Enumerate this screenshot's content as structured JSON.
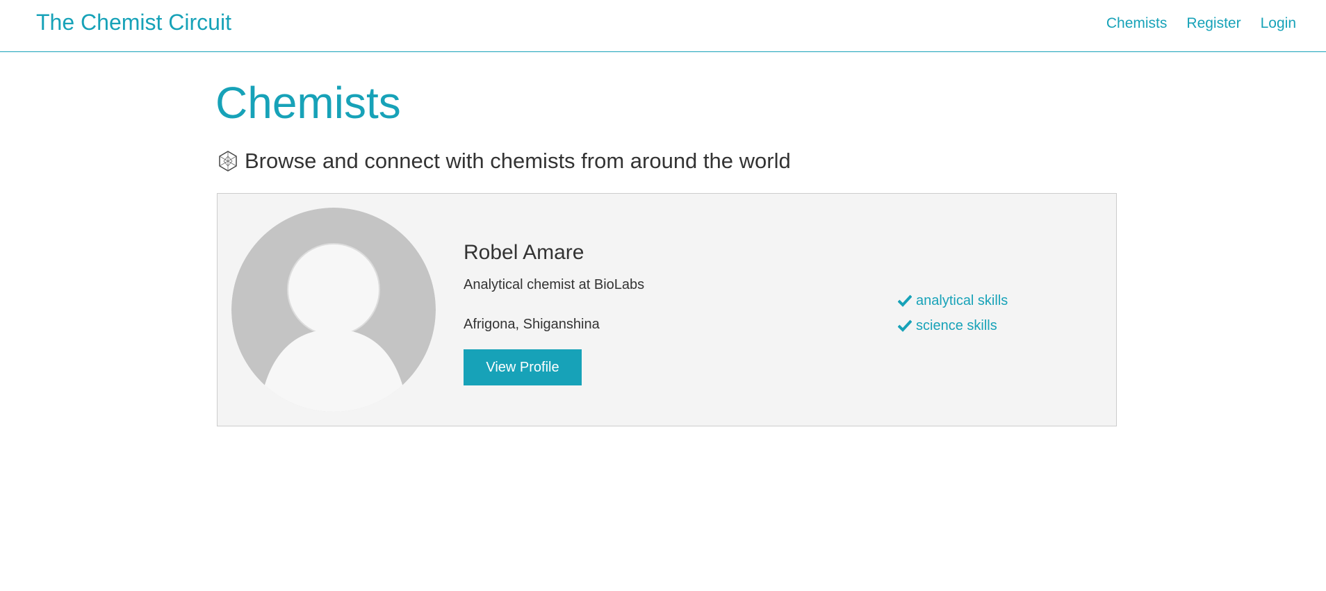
{
  "navbar": {
    "brand": "The Chemist Circuit",
    "links": [
      {
        "label": "Chemists"
      },
      {
        "label": "Register"
      },
      {
        "label": "Login"
      }
    ]
  },
  "page": {
    "title": "Chemists",
    "lead_icon": "molecule-icon",
    "lead": "Browse and connect with chemists from around the world"
  },
  "profiles": [
    {
      "avatar_icon": "default-avatar",
      "name": "Robel Amare",
      "title": "Analytical chemist at BioLabs",
      "location": "Afrigona, Shiganshina",
      "button_label": "View Profile",
      "skills": [
        {
          "icon": "check-icon",
          "label": "analytical skills"
        },
        {
          "icon": "check-icon",
          "label": "science skills"
        }
      ]
    }
  ],
  "colors": {
    "accent": "#17a2b8",
    "card_bg": "#f4f4f4",
    "text": "#333333"
  }
}
